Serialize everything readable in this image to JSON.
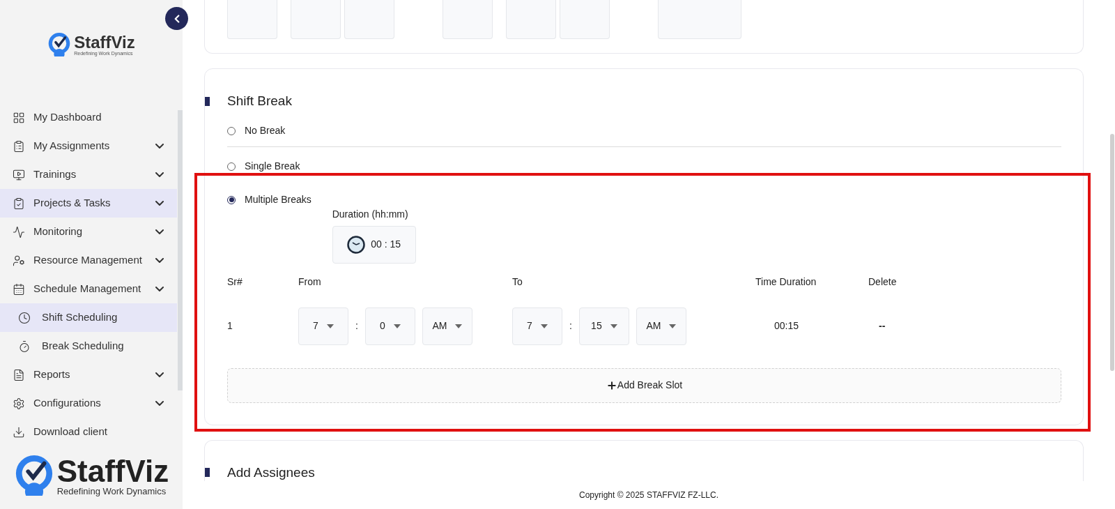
{
  "sidebar": {
    "logo": {
      "name": "StaffViz",
      "tagline": "Redefining Work Dynamics"
    },
    "items": [
      {
        "label": "My Dashboard",
        "expandable": false,
        "selected": false
      },
      {
        "label": "My Assignments",
        "expandable": true,
        "selected": false
      },
      {
        "label": "Trainings",
        "expandable": true,
        "selected": false
      },
      {
        "label": "Projects & Tasks",
        "expandable": true,
        "selected": true
      },
      {
        "label": "Monitoring",
        "expandable": true,
        "selected": false
      },
      {
        "label": "Resource Management",
        "expandable": true,
        "selected": false
      },
      {
        "label": "Schedule Management",
        "expandable": true,
        "selected": false,
        "children": [
          {
            "label": "Shift Scheduling",
            "selected": true
          },
          {
            "label": "Break Scheduling",
            "selected": false
          }
        ]
      },
      {
        "label": "Reports",
        "expandable": true,
        "selected": false
      },
      {
        "label": "Configurations",
        "expandable": true,
        "selected": false
      },
      {
        "label": "Download client",
        "expandable": false,
        "selected": false
      }
    ],
    "footer_logo": {
      "name": "StaffViz",
      "tagline": "Redefining Work Dynamics"
    }
  },
  "shift_break": {
    "title": "Shift Break",
    "options": [
      {
        "label": "No Break",
        "selected": false
      },
      {
        "label": "Single Break",
        "selected": false
      },
      {
        "label": "Multiple Breaks",
        "selected": true
      }
    ],
    "duration": {
      "label": "Duration (hh:mm)",
      "value": "00 : 15"
    },
    "table": {
      "separator": ":",
      "columns": [
        "Sr#",
        "From",
        "To",
        "Time Duration",
        "Delete"
      ],
      "rows": [
        {
          "sr": "1",
          "from": {
            "hour": "7",
            "minute": "0",
            "period": "AM"
          },
          "to": {
            "hour": "7",
            "minute": "15",
            "period": "AM"
          },
          "duration": "00:15",
          "delete": "--"
        }
      ]
    },
    "add_button": "Add Break Slot"
  },
  "assignees": {
    "title": "Add Assignees"
  },
  "footer": {
    "copyright": "Copyright © 2025 STAFFVIZ FZ-LLC."
  }
}
